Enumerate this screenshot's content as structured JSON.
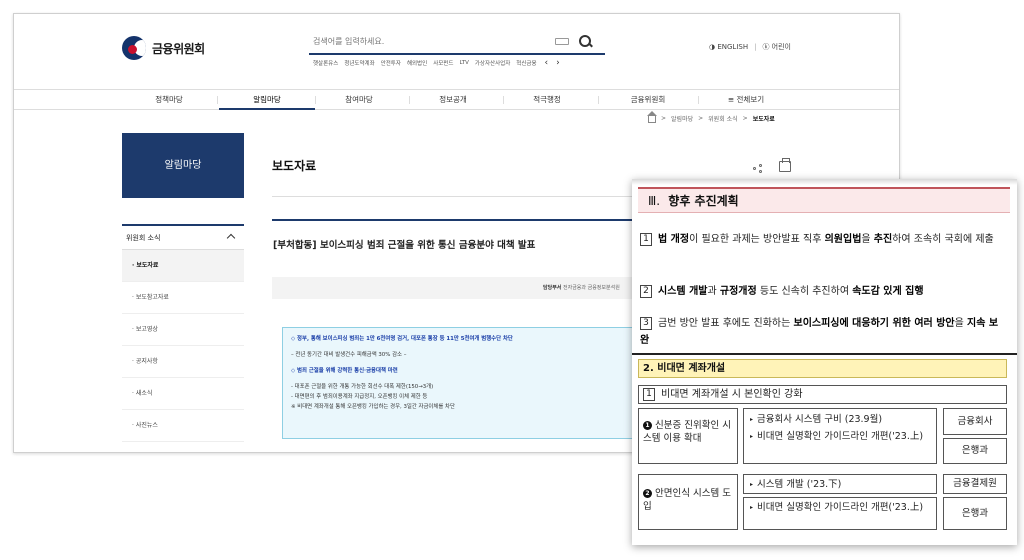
{
  "header": {
    "logo_text": "금융위원회",
    "search_placeholder": "검색어를 입력하세요.",
    "keywords": [
      "햇살론유스",
      "청년도약계좌",
      "안전투자",
      "해외법인",
      "사모펀드",
      "LTV",
      "가상자산사업자",
      "혁신금융"
    ],
    "kw_prev": "‹",
    "kw_next": "›",
    "english": "◑ ENGLISH",
    "kids": "ⓚ 어린이"
  },
  "gnb": {
    "items": [
      "정책마당",
      "알림마당",
      "참여마당",
      "정보공개",
      "적극행정",
      "금융위원회",
      "≡ 전체보기"
    ]
  },
  "breadcrumb": {
    "items": [
      "알림마당",
      "위원회 소식",
      "보도자료"
    ],
    "sep": ">"
  },
  "sidebar": {
    "title": "알림마당",
    "section": "위원회 소식",
    "items": [
      "· 보도자료",
      "· 보도참고자료",
      "· 보고영상",
      "· 공지사항",
      "· 새소식",
      "· 사진뉴스"
    ]
  },
  "content": {
    "page_title": "보도자료",
    "article_title": "[부처합동] 보이스피싱 범죄 근절을 위한 통신 금융분야 대책 발표",
    "meta_label": "담당부서",
    "meta_value": "전자금융과 금융정보분석원",
    "summary": [
      "◇ 정부, 통해 보이스피싱 범죄는 1만 6천여명 검거, 대포폰 통장 등 11만 5천여개 범행수단 차단",
      "– 전년 동기간 대비 발생건수 피해금액 30% 감소 –",
      "◇ 범죄 근절을 위해 강력한 통신·금융대책 마련",
      "- 대포폰 근절을 위한 개통 가능한 회선수 대폭 제한(150→3개)",
      "- 대면편의 후 범죄이용계좌 지급정지, 오픈뱅킹 이체 제한 등",
      "※ 비대면 계좌개설 통해 오픈뱅킹 가입하는 경우, 3일간 자금이체를 차단"
    ]
  },
  "doc": {
    "plan_roman": "Ⅲ.",
    "plan_title": "향후 추진계획",
    "plan_items": [
      {
        "num": "1",
        "pre": "",
        "b1": "법 개정",
        "mid": "이 필요한 과제는 방안발표 직후 ",
        "b2": "의원입법",
        "post": "을 ",
        "b3": "추진",
        "end": "하여 조속히 국회에 제출"
      },
      {
        "num": "2",
        "pre": "",
        "b1": "시스템 개발",
        "mid": "과 ",
        "b2": "규정개정",
        "post": " 등도 신속히 추진하여 ",
        "b3": "속도감 있게 집행",
        "end": ""
      },
      {
        "num": "3",
        "pre": "금번 방안 발표 후에도 진화하는 ",
        "b1": "보이스피싱에 대응하기 위한 여러 방안",
        "mid": "을 ",
        "b2": "지속 보완",
        "post": "",
        "b3": "",
        "end": ""
      }
    ],
    "section_title": "2. 비대면 계좌개설",
    "sub_num": "1",
    "sub_title": "비대면 계좌개설 시 본인확인 강화",
    "rows": [
      {
        "num": "❶",
        "label": "신분증 진위확인 시스템 이용 확대",
        "tasks": [
          "금융회사 시스템 구비 (23.9월)",
          "비대면 실명확인 가이드라인 개편('23.上)"
        ],
        "owners": [
          "금융회사",
          "은행과"
        ]
      },
      {
        "num": "❷",
        "label": "안면인식 시스템 도입",
        "tasks": [
          "시스템 개발 ('23.下)",
          "비대면 실명확인 가이드라인 개편('23.上)"
        ],
        "owners": [
          "금융결제원",
          "은행과"
        ]
      }
    ]
  }
}
